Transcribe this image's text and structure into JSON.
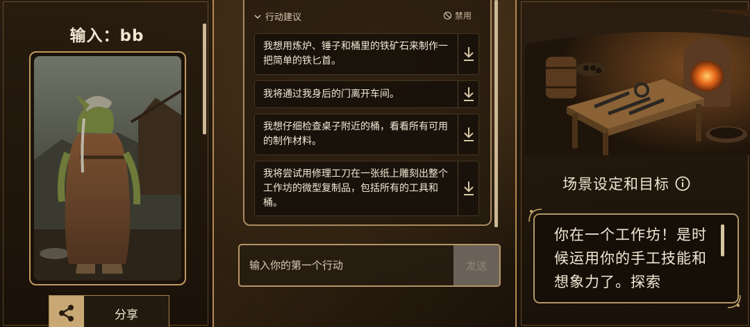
{
  "character": {
    "title": "输入：bb"
  },
  "share": {
    "label": "分享",
    "icon": "share-icon"
  },
  "suggestions_panel": {
    "header": "行动建议",
    "disable_label": "禁用",
    "items": [
      {
        "text": "我想用炼炉、锤子和桶里的铁矿石来制作一把简单的铁匕首。"
      },
      {
        "text": "我将通过我身后的门离开车间。"
      },
      {
        "text": "我想仔细检查桌子附近的桶，看看所有可用的制作材料。"
      },
      {
        "text": "我将尝试用修理工刀在一张纸上雕刻出整个工作坊的微型复制品，包括所有的工具和桶。"
      }
    ]
  },
  "action_input": {
    "placeholder": "输入你的第一个行动",
    "send_label": "发送"
  },
  "scene": {
    "title": "场景设定和目标",
    "description": "你在一个工作坊！是时候运用你的手工技能和想象力了。探索"
  },
  "colors": {
    "accent_gold": "#b48a52",
    "panel_bg": "#1d140a",
    "text_light": "#f1e8d6",
    "send_disabled": "#6a6258"
  }
}
